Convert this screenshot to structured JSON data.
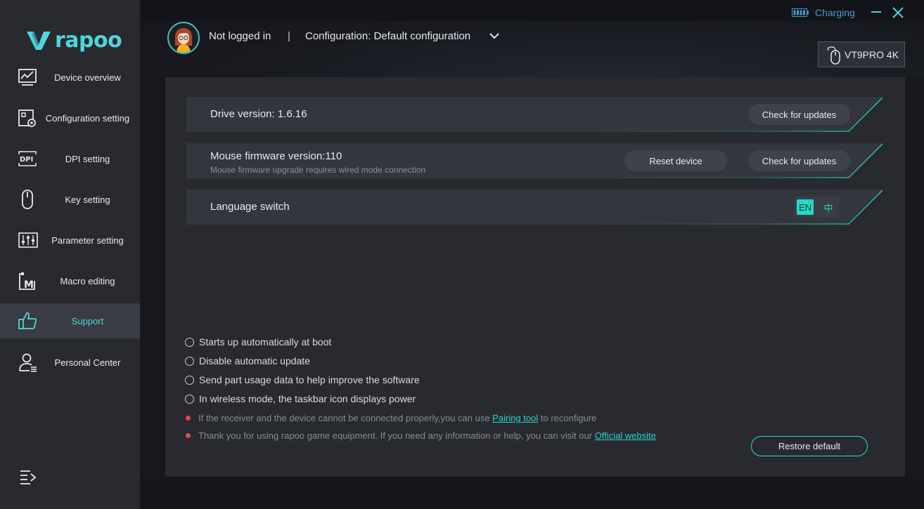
{
  "app": {
    "logo_text": "rapoo"
  },
  "sidebar": {
    "items": [
      {
        "label": "Device overview",
        "icon": "device-overview-icon"
      },
      {
        "label": "Configuration setting",
        "icon": "configuration-icon"
      },
      {
        "label": "DPI setting",
        "icon": "dpi-icon"
      },
      {
        "label": "Key setting",
        "icon": "mouse-key-icon"
      },
      {
        "label": "Parameter setting",
        "icon": "sliders-icon"
      },
      {
        "label": "Macro editing",
        "icon": "macro-icon"
      },
      {
        "label": "Support",
        "icon": "thumbs-up-icon",
        "active": true
      },
      {
        "label": "Personal Center",
        "icon": "user-icon"
      }
    ]
  },
  "header": {
    "user_status": "Not logged in",
    "separator": "|",
    "configuration": "Configuration: Default configuration",
    "charging": "Charging",
    "device": "VT9PRO 4K"
  },
  "support": {
    "drive_version": "Drive version: 1.6.16",
    "drive_check": "Check for updates",
    "firmware_version": "Mouse firmware version:110",
    "firmware_note": "Mouse firmware upgrade requires wired mode connection",
    "reset_device": "Reset device",
    "firmware_check": "Check for updates",
    "language_label": "Language switch",
    "lang_en": "EN",
    "lang_zh": "中",
    "options": [
      "Starts up automatically at boot",
      "Disable automatic update",
      "Send part usage data to help improve the software",
      "In wireless mode, the taskbar icon displays power"
    ],
    "note1_text": "If the receiver and the device cannot be connected properly,you can use",
    "note1_link": "Pairing tool",
    "note1_tail": "to reconfigure",
    "note2_text": "Thank you for using rapoo game equipment. If you need any information or help, you can visit our",
    "note2_link": "Official website",
    "restore_default": "Restore default"
  },
  "colors": {
    "accent": "#22d8c8",
    "brand": "#4fd6d8",
    "charging": "#3f9bd4",
    "note_dot": "#e0455a"
  }
}
